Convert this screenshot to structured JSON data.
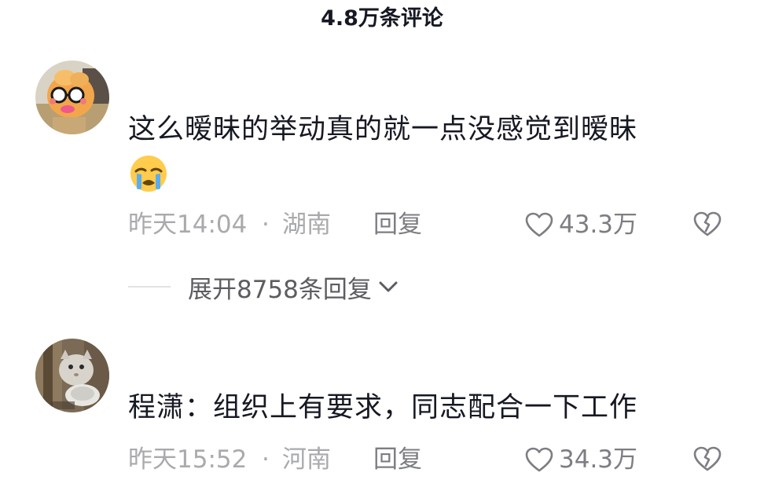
{
  "header": {
    "title": "4.8万条评论"
  },
  "comments": [
    {
      "text": "这么暧昧的举动真的就一点没感觉到暧昧",
      "emoji": "loudly-crying-face-emoji",
      "time": "昨天14:04",
      "separator": "·",
      "location": "湖南",
      "reply_label": "回复",
      "likes": "43.3万",
      "avatar": "orange-plush-doll-with-sunglasses",
      "expand_label": "展开8758条回复"
    },
    {
      "text": "程潇：组织上有要求，同志配合一下工作",
      "time": "昨天15:52",
      "separator": "·",
      "location": "河南",
      "reply_label": "回复",
      "likes": "34.3万",
      "avatar": "white-cat-photo"
    }
  ],
  "icons": {
    "like": "heart-outline-icon",
    "dislike": "broken-heart-icon",
    "expand": "chevron-down-icon"
  },
  "colors": {
    "primary_text": "#161823",
    "meta_text": "#a9aaad",
    "action_text": "#7d7e83",
    "divider": "#e1e2e4"
  }
}
